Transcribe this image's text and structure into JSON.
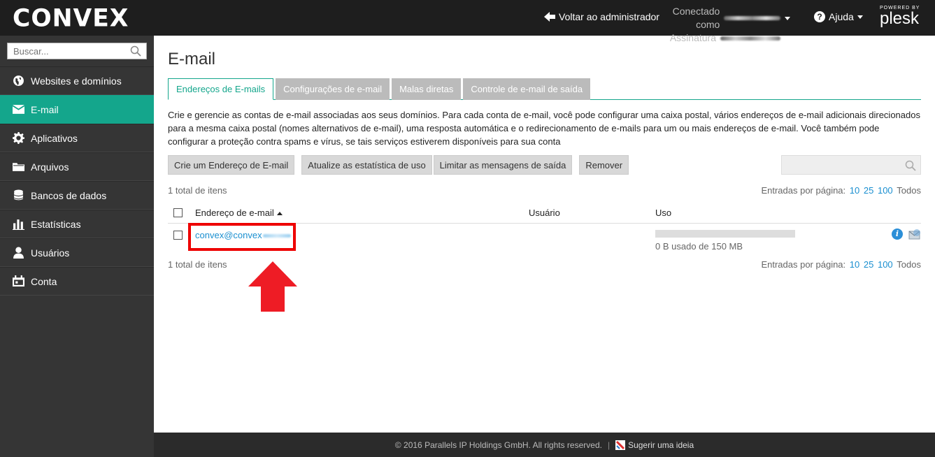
{
  "brand": {
    "logo_text": "CONVEX",
    "powered_by": "POWERED BY",
    "plesk": "plesk"
  },
  "header": {
    "back_admin": "Voltar ao administrador",
    "connected_as": "Conectado como",
    "subscription": "Assinatura",
    "help": "Ajuda"
  },
  "sidebar": {
    "search_placeholder": "Buscar...",
    "items": [
      {
        "label": "Websites e domínios",
        "icon": "globe-icon"
      },
      {
        "label": "E-mail",
        "icon": "envelope-icon",
        "active": true
      },
      {
        "label": "Aplicativos",
        "icon": "gear-icon"
      },
      {
        "label": "Arquivos",
        "icon": "folder-icon"
      },
      {
        "label": "Bancos de dados",
        "icon": "database-icon"
      },
      {
        "label": "Estatísticas",
        "icon": "bar-chart-icon"
      },
      {
        "label": "Usuários",
        "icon": "user-icon"
      },
      {
        "label": "Conta",
        "icon": "calendar-icon"
      }
    ]
  },
  "main": {
    "title": "E-mail",
    "tabs": [
      {
        "label": "Endereços de E-mails",
        "active": true
      },
      {
        "label": "Configurações de e-mail"
      },
      {
        "label": "Malas diretas"
      },
      {
        "label": "Controle de e-mail de saída"
      }
    ],
    "description": "Crie e gerencie as contas de e-mail associadas aos seus domínios. Para cada conta de e-mail, você pode configurar uma caixa postal, vários endereços de e-mail adicionais direcionados para a mesma caixa postal (nomes alternativos de e-mail), uma resposta automática e o redirecionamento de e-mails para um ou mais endereços de e-mail. Você também pode configurar a proteção contra spams e vírus, se tais serviços estiverem disponíveis para sua conta",
    "toolbar": {
      "create": "Crie um Endereço de E-mail",
      "update_stats": "Atualize as estatística de uso",
      "limit": "Limitar as mensagens de saída",
      "remove": "Remover"
    },
    "total": "1 total de itens",
    "per_page_label": "Entradas por página:",
    "per_page_options": [
      "10",
      "25",
      "100"
    ],
    "per_page_all": "Todos",
    "columns": {
      "address": "Endereço de e-mail",
      "user": "Usuário",
      "usage": "Uso"
    },
    "rows": [
      {
        "address": "convex@convex",
        "user": "",
        "usage_text": "0 B usado de 150 MB",
        "usage_fraction": 0
      }
    ]
  },
  "footer": {
    "copyright": "© 2016 Parallels IP Holdings GmbH. All rights reserved.",
    "suggest": "Sugerir uma ideia"
  },
  "colors": {
    "accent": "#14a68c",
    "link": "#1a8fd0",
    "highlight": "#e00000"
  }
}
